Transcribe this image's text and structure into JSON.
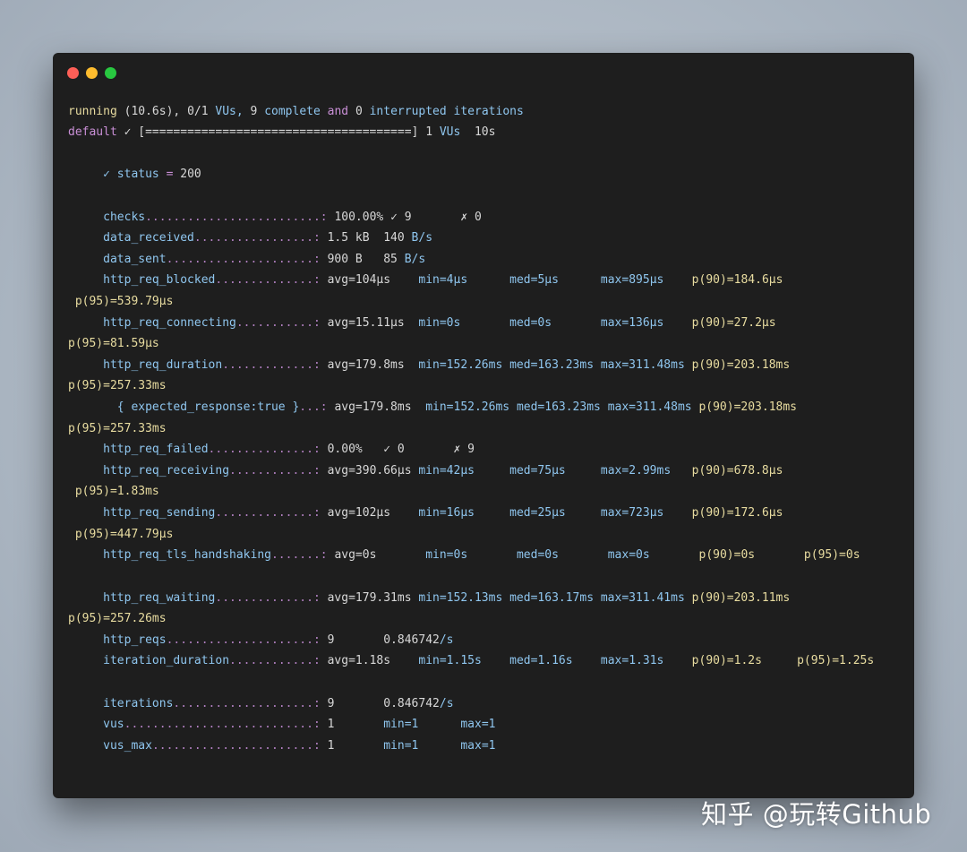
{
  "window": {
    "controls": [
      "close",
      "minimize",
      "maximize"
    ]
  },
  "progress": {
    "running_word": "running",
    "elapsed": "(10.6s),",
    "vus_ratio": "0/1",
    "vus_label": "VUs,",
    "complete_count": "9",
    "complete_word": "complete",
    "and_word": "and",
    "interrupted_count": "0",
    "interrupted_word": "interrupted",
    "iterations_word": "iterations",
    "scenario_name": "default",
    "scenario_check": "✓",
    "bar": "[======================================]",
    "bar_fraction": 1.0,
    "bar_vus_count": "1",
    "bar_vus_word": "VUs",
    "bar_duration": "10s"
  },
  "check": {
    "mark": "✓",
    "name": "status",
    "op": "=",
    "value": "200"
  },
  "metrics": {
    "checks": {
      "name": "checks",
      "dots": ".........................:",
      "v1": "100.00%",
      "v2": "✓ 9",
      "v3": "✗ 0"
    },
    "data_received": {
      "name": "data_received",
      "dots": ".................:",
      "v1": "1.5 kB",
      "v2a": "140",
      "v2b": "B/s"
    },
    "data_sent": {
      "name": "data_sent",
      "dots": ".....................:",
      "v1": "900 B",
      "v2a": "85",
      "v2b": "B/s"
    },
    "blocked": {
      "name": "http_req_blocked",
      "dots": "..............:",
      "avg": "avg=104µs",
      "min": "min=4µs",
      "med": "med=5µs",
      "max": "max=895µs",
      "p90": "p(90)=184.6µs",
      "p95": "p(95)=539.79µs"
    },
    "connecting": {
      "name": "http_req_connecting",
      "dots": "...........:",
      "avg": "avg=15.11µs",
      "min": "min=0s",
      "med": "med=0s",
      "max": "max=136µs",
      "p90": "p(90)=27.2µs",
      "p95": "p(95)=81.59µs"
    },
    "duration": {
      "name": "http_req_duration",
      "dots": ".............:",
      "avg": "avg=179.8ms",
      "min": "min=152.26ms",
      "med": "med=163.23ms",
      "max": "max=311.48ms",
      "p90": "p(90)=203.18ms",
      "p95": "p(95)=257.33ms"
    },
    "expected": {
      "name": "{ expected_response:true }",
      "dots": "...:",
      "avg": "avg=179.8ms",
      "min": "min=152.26ms",
      "med": "med=163.23ms",
      "max": "max=311.48ms",
      "p90": "p(90)=203.18ms",
      "p95": "p(95)=257.33ms"
    },
    "failed": {
      "name": "http_req_failed",
      "dots": "...............:",
      "v1": "0.00%",
      "v2": "✓ 0",
      "v3": "✗ 9"
    },
    "receiving": {
      "name": "http_req_receiving",
      "dots": "............:",
      "avg": "avg=390.66µs",
      "min": "min=42µs",
      "med": "med=75µs",
      "max": "max=2.99ms",
      "p90": "p(90)=678.8µs",
      "p95": "p(95)=1.83ms"
    },
    "sending": {
      "name": "http_req_sending",
      "dots": "..............:",
      "avg": "avg=102µs",
      "min": "min=16µs",
      "med": "med=25µs",
      "max": "max=723µs",
      "p90": "p(90)=172.6µs",
      "p95": "p(95)=447.79µs"
    },
    "tls": {
      "name": "http_req_tls_handshaking",
      "dots": ".......:",
      "avg": "avg=0s",
      "min": "min=0s",
      "med": "med=0s",
      "max": "max=0s",
      "p90": "p(90)=0s",
      "p95": "p(95)=0s"
    },
    "waiting": {
      "name": "http_req_waiting",
      "dots": "..............:",
      "avg": "avg=179.31ms",
      "min": "min=152.13ms",
      "med": "med=163.17ms",
      "max": "max=311.41ms",
      "p90": "p(90)=203.11ms",
      "p95": "p(95)=257.26ms"
    },
    "reqs": {
      "name": "http_reqs",
      "dots": ".....................:",
      "v1": "9",
      "v2a": "0.846742",
      "v2b": "/s"
    },
    "iter_duration": {
      "name": "iteration_duration",
      "dots": "............:",
      "avg": "avg=1.18s",
      "min": "min=1.15s",
      "med": "med=1.16s",
      "max": "max=1.31s",
      "p90": "p(90)=1.2s",
      "p95": "p(95)=1.25s"
    },
    "iterations": {
      "name": "iterations",
      "dots": "....................:",
      "v1": "9",
      "v2a": "0.846742",
      "v2b": "/s"
    },
    "vus": {
      "name": "vus",
      "dots": "...........................:",
      "v1": "1",
      "v2": "min=1",
      "v3": "max=1"
    },
    "vus_max": {
      "name": "vus_max",
      "dots": ".......................:",
      "v1": "1",
      "v2": "min=1",
      "v3": "max=1"
    }
  },
  "watermark": "知乎 @玩转Github",
  "colors": {
    "background": "#a9b4c0",
    "terminal_bg": "#1e1e1e",
    "close": "#fe5f57",
    "minimize": "#febc2e",
    "maximize": "#28c840",
    "metric_name": "#8fc6ef",
    "dots": "#b07fc0",
    "keyword": "#c98fd6",
    "text": "#e8dca0"
  }
}
